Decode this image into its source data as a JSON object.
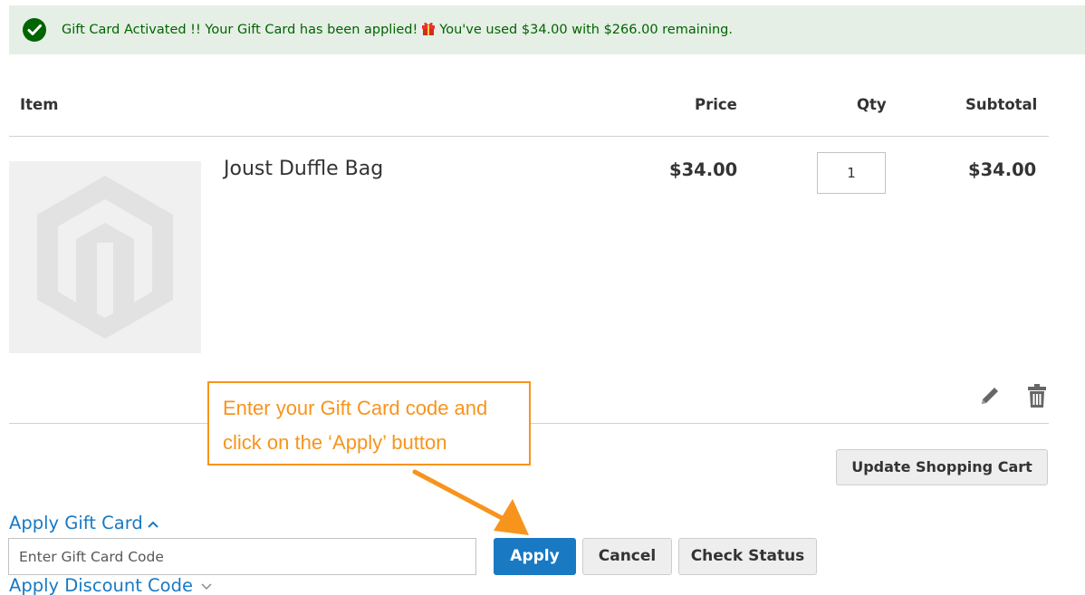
{
  "message": {
    "before_icon": "Gift Card Activated !! Your Gift Card has been applied!",
    "after_icon": "You've used $34.00 with $266.00 remaining.",
    "status_icon": "check-circle-icon",
    "gift_icon": "gift-icon",
    "colors": {
      "background": "#e5efe5",
      "text": "#006400",
      "icon": "#006400"
    }
  },
  "table": {
    "headers": {
      "item": "Item",
      "price": "Price",
      "qty": "Qty",
      "subtotal": "Subtotal"
    },
    "rows": [
      {
        "name": "Joust Duffle Bag",
        "price": "$34.00",
        "qty": "1",
        "subtotal": "$34.00",
        "thumbnail_icon": "magento-logo-placeholder-icon"
      }
    ]
  },
  "actions": {
    "edit_icon": "pencil-icon",
    "delete_icon": "trash-icon",
    "update_label": "Update Shopping Cart"
  },
  "callout": {
    "line1": "Enter your Gift Card code and",
    "line2": "click on the ‘Apply’ button",
    "color": "#f7941d"
  },
  "gift_card": {
    "title": "Apply Gift Card",
    "placeholder": "Enter Gift Card Code",
    "apply_label": "Apply",
    "cancel_label": "Cancel",
    "check_label": "Check Status",
    "accent": "#1979c3"
  },
  "discount": {
    "title": "Apply Discount Code"
  }
}
